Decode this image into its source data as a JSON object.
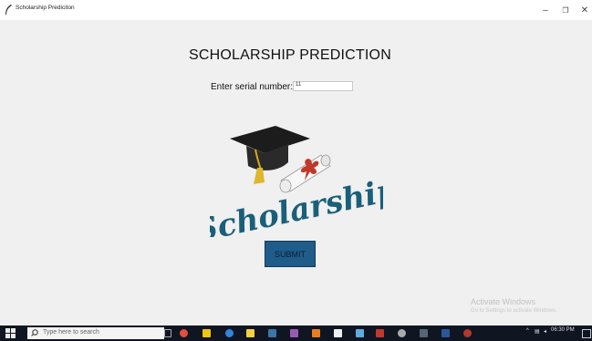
{
  "window": {
    "title": "Scholarship Prediciton",
    "controls": {
      "minimize": "–",
      "maximize": "❐",
      "close": "✕"
    }
  },
  "app": {
    "heading": "SCHOLARSHIP PREDICTION",
    "serial_label": "Enter serial number:",
    "serial_value": "11",
    "logo_text": "Scholarship",
    "submit_label": "SUBMIT"
  },
  "watermark": {
    "line1": "Activate Windows",
    "line2": "Go to Settings to activate Windows."
  },
  "taskbar": {
    "search_placeholder": "Type here to search",
    "clock_time": "06:30 PM",
    "tray_icons": [
      "chevron-up-icon",
      "network-icon",
      "speaker-icon",
      "notification-icon"
    ],
    "pinned_icons": [
      "task-view-icon",
      "chrome-icon",
      "file-explorer-icon",
      "edge-icon",
      "sticky-notes-icon",
      "python-icon",
      "paint-icon",
      "store-icon",
      "notepad-icon",
      "app-icon",
      "acrobat-icon",
      "settings-icon",
      "terminal-icon",
      "word-icon",
      "spider-icon"
    ]
  }
}
